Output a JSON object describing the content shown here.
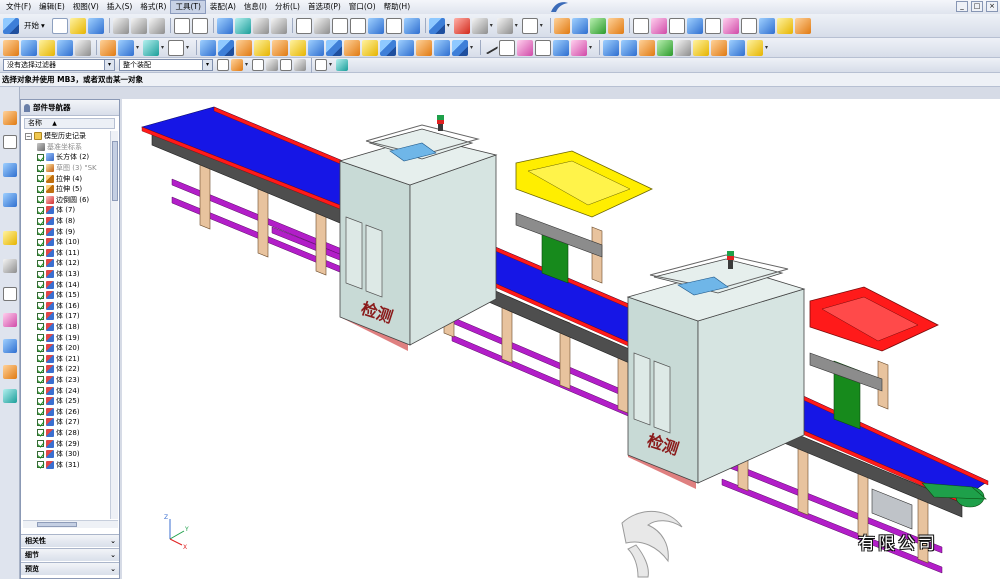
{
  "menu": {
    "items": [
      "文件(F)",
      "编辑(E)",
      "视图(V)",
      "插入(S)",
      "格式(R)",
      "工具(T)",
      "装配(A)",
      "信息(I)",
      "分析(L)",
      "首选项(P)",
      "窗口(O)",
      "帮助(H)"
    ],
    "active_index": 5
  },
  "window_controls": [
    "_",
    "□",
    "×"
  ],
  "toolbar": {
    "start_label": "开始"
  },
  "selection": {
    "type_filter": "没有选择过滤器",
    "assembly_scope": "整个装配"
  },
  "cue_line": "选择对象并使用 MB3，或者双击某一对象",
  "navigator": {
    "title": "部件导航器",
    "column_name": "名称",
    "sort_glyph": "▲",
    "rows": [
      {
        "label": "模型历史记录",
        "level": 0,
        "checkbox": false,
        "expander": "−",
        "icon": "fi-folder",
        "dim": false
      },
      {
        "label": "基准坐标系",
        "level": 1,
        "checkbox": false,
        "expander": "",
        "icon": "fi-datum",
        "dim": true
      },
      {
        "label": "长方体 (2)",
        "level": 1,
        "checkbox": true,
        "expander": "",
        "icon": "fi-block",
        "dim": false
      },
      {
        "label": "草图 (3) \"SK",
        "level": 1,
        "checkbox": true,
        "expander": "",
        "icon": "fi-sketch",
        "dim": true
      },
      {
        "label": "拉伸 (4)",
        "level": 1,
        "checkbox": true,
        "expander": "",
        "icon": "fi-extrude",
        "dim": false
      },
      {
        "label": "拉伸 (5)",
        "level": 1,
        "checkbox": true,
        "expander": "",
        "icon": "fi-extrude",
        "dim": false
      },
      {
        "label": "边倒圆 (6)",
        "level": 1,
        "checkbox": true,
        "expander": "",
        "icon": "fi-edge",
        "dim": false
      },
      {
        "label": "体 (7)",
        "level": 1,
        "checkbox": true,
        "expander": "",
        "icon": "fi-body",
        "dim": false
      },
      {
        "label": "体 (8)",
        "level": 1,
        "checkbox": true,
        "expander": "",
        "icon": "fi-body",
        "dim": false
      },
      {
        "label": "体 (9)",
        "level": 1,
        "checkbox": true,
        "expander": "",
        "icon": "fi-body",
        "dim": false
      },
      {
        "label": "体 (10)",
        "level": 1,
        "checkbox": true,
        "expander": "",
        "icon": "fi-body",
        "dim": false
      },
      {
        "label": "体 (11)",
        "level": 1,
        "checkbox": true,
        "expander": "",
        "icon": "fi-body",
        "dim": false
      },
      {
        "label": "体 (12)",
        "level": 1,
        "checkbox": true,
        "expander": "",
        "icon": "fi-body",
        "dim": false
      },
      {
        "label": "体 (13)",
        "level": 1,
        "checkbox": true,
        "expander": "",
        "icon": "fi-body",
        "dim": false
      },
      {
        "label": "体 (14)",
        "level": 1,
        "checkbox": true,
        "expander": "",
        "icon": "fi-body",
        "dim": false
      },
      {
        "label": "体 (15)",
        "level": 1,
        "checkbox": true,
        "expander": "",
        "icon": "fi-body",
        "dim": false
      },
      {
        "label": "体 (16)",
        "level": 1,
        "checkbox": true,
        "expander": "",
        "icon": "fi-body",
        "dim": false
      },
      {
        "label": "体 (17)",
        "level": 1,
        "checkbox": true,
        "expander": "",
        "icon": "fi-body",
        "dim": false
      },
      {
        "label": "体 (18)",
        "level": 1,
        "checkbox": true,
        "expander": "",
        "icon": "fi-body",
        "dim": false
      },
      {
        "label": "体 (19)",
        "level": 1,
        "checkbox": true,
        "expander": "",
        "icon": "fi-body",
        "dim": false
      },
      {
        "label": "体 (20)",
        "level": 1,
        "checkbox": true,
        "expander": "",
        "icon": "fi-body",
        "dim": false
      },
      {
        "label": "体 (21)",
        "level": 1,
        "checkbox": true,
        "expander": "",
        "icon": "fi-body",
        "dim": false
      },
      {
        "label": "体 (22)",
        "level": 1,
        "checkbox": true,
        "expander": "",
        "icon": "fi-body",
        "dim": false
      },
      {
        "label": "体 (23)",
        "level": 1,
        "checkbox": true,
        "expander": "",
        "icon": "fi-body",
        "dim": false
      },
      {
        "label": "体 (24)",
        "level": 1,
        "checkbox": true,
        "expander": "",
        "icon": "fi-body",
        "dim": false
      },
      {
        "label": "体 (25)",
        "level": 1,
        "checkbox": true,
        "expander": "",
        "icon": "fi-body",
        "dim": false
      },
      {
        "label": "体 (26)",
        "level": 1,
        "checkbox": true,
        "expander": "",
        "icon": "fi-body",
        "dim": false
      },
      {
        "label": "体 (27)",
        "level": 1,
        "checkbox": true,
        "expander": "",
        "icon": "fi-body",
        "dim": false
      },
      {
        "label": "体 (28)",
        "level": 1,
        "checkbox": true,
        "expander": "",
        "icon": "fi-body",
        "dim": false
      },
      {
        "label": "体 (29)",
        "level": 1,
        "checkbox": true,
        "expander": "",
        "icon": "fi-body",
        "dim": false
      },
      {
        "label": "体 (30)",
        "level": 1,
        "checkbox": true,
        "expander": "",
        "icon": "fi-body",
        "dim": false
      },
      {
        "label": "体 (31)",
        "level": 1,
        "checkbox": true,
        "expander": "",
        "icon": "fi-body",
        "dim": false
      }
    ],
    "panels": [
      "相关性",
      "细节",
      "预览"
    ]
  },
  "viewport": {
    "station_label": "检测",
    "watermark": "有限公司",
    "triad": {
      "x": "X",
      "y": "Y",
      "z": "Z"
    },
    "colors": {
      "belt_top": "#1616e6",
      "belt_edge": "#ff1a1a",
      "frame": "#4e4e4e",
      "legs": "#e8c39e",
      "rails": "#b21ec8",
      "station_body": "#c8dad6",
      "hopper_yellow": "#ffee00",
      "hopper_red": "#ff1a1a",
      "door_green": "#178a1c",
      "roller_green": "#1ea04a"
    }
  }
}
